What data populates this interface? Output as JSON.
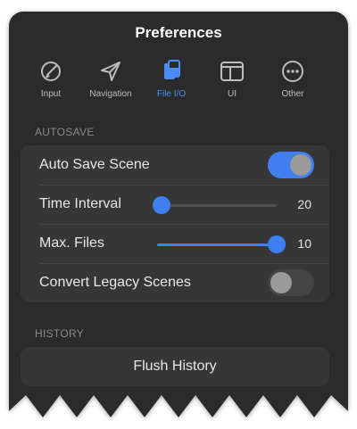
{
  "title": "Preferences",
  "tabs": [
    {
      "label": "Input",
      "icon": "pencil-circle-icon",
      "active": false
    },
    {
      "label": "Navigation",
      "icon": "paper-plane-icon",
      "active": false
    },
    {
      "label": "File I/O",
      "icon": "documents-icon",
      "active": true
    },
    {
      "label": "UI",
      "icon": "window-layout-icon",
      "active": false
    },
    {
      "label": "Other",
      "icon": "ellipsis-circle-icon",
      "active": false
    }
  ],
  "autosave": {
    "header": "AUTOSAVE",
    "auto_save_scene": {
      "label": "Auto Save Scene",
      "on": true
    },
    "time_interval": {
      "label": "Time Interval",
      "value": "20",
      "fraction": 0.04
    },
    "max_files": {
      "label": "Max. Files",
      "value": "10",
      "fraction": 1.0
    },
    "convert_legacy": {
      "label": "Convert Legacy Scenes",
      "on": false
    }
  },
  "history": {
    "header": "HISTORY",
    "flush_label": "Flush History"
  },
  "colors": {
    "accent": "#3f7ff0",
    "panel": "#2b2b2b",
    "group": "#363636",
    "active_tab": "#4b8df8"
  }
}
